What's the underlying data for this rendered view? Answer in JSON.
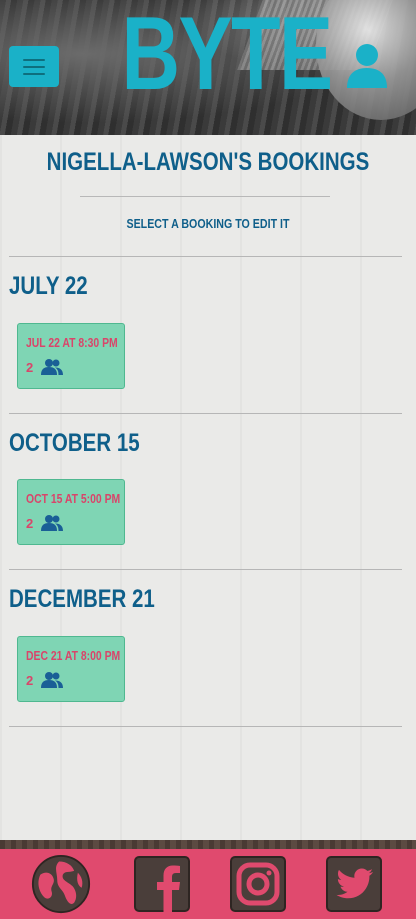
{
  "header": {
    "logo_text": "BYTE",
    "menu_icon": "hamburger-menu-icon",
    "user_icon": "user-icon"
  },
  "page": {
    "title": "Nigella-Lawson's Bookings",
    "subtitle": "Select a booking to edit it"
  },
  "sections": [
    {
      "month_label": "July 22",
      "bookings": [
        {
          "time_label": "Jul 22 at 8:30 PM",
          "guests": "2"
        }
      ]
    },
    {
      "month_label": "October 15",
      "bookings": [
        {
          "time_label": "Oct 15 at 5:00 PM",
          "guests": "2"
        }
      ]
    },
    {
      "month_label": "December 21",
      "bookings": [
        {
          "time_label": "Dec 21 at 8:00 PM",
          "guests": "2"
        }
      ]
    }
  ],
  "footer": {
    "links": [
      {
        "name": "website",
        "icon": "globe-icon"
      },
      {
        "name": "facebook",
        "icon": "facebook-icon"
      },
      {
        "name": "instagram",
        "icon": "instagram-icon"
      },
      {
        "name": "twitter",
        "icon": "twitter-icon"
      }
    ]
  },
  "colors": {
    "brand_teal": "#1ab1c8",
    "heading_blue": "#0f5f8a",
    "card_green": "#7fd5b4",
    "accent_pink": "#e04a6e",
    "booking_text": "#d9456a"
  }
}
